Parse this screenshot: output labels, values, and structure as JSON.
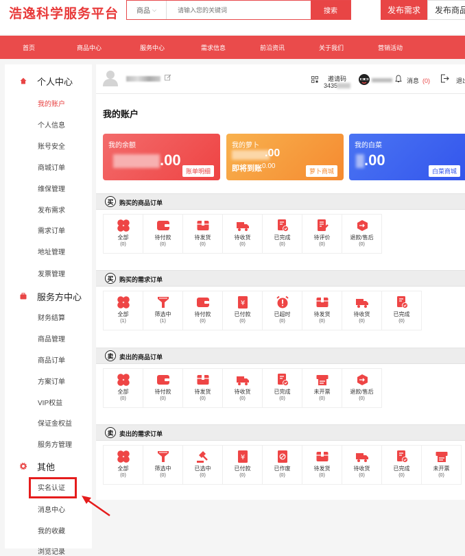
{
  "logo": "浩逸科学服务平台",
  "search": {
    "category": "商品",
    "placeholder": "请输入您的关键词",
    "button": "搜索"
  },
  "header_buttons": {
    "publish_request": "发布需求",
    "publish_goods": "发布商品"
  },
  "nav": [
    "首页",
    "商品中心",
    "服务中心",
    "需求信息",
    "前沿资讯",
    "关于我们",
    "营销活动"
  ],
  "sidebar": {
    "personal_center": "个人中心",
    "personal_items": [
      "我的账户",
      "个人信息",
      "账号安全",
      "商城订单",
      "维保管理",
      "发布需求",
      "需求订单",
      "地址管理",
      "发票管理"
    ],
    "service_center": "服务方中心",
    "service_items": [
      "财务结算",
      "商品管理",
      "商品订单",
      "方案订单",
      "VIP权益",
      "保证金权益",
      "服务方管理"
    ],
    "other": "其他",
    "other_items": [
      "实名认证",
      "消息中心",
      "我的收藏",
      "浏览记录"
    ]
  },
  "user": {
    "invite_label": "邀请码",
    "invite_code_prefix": "3435",
    "messages_label": "消息",
    "messages_count": "(0)",
    "logout": "退出"
  },
  "page_title": "我的账户",
  "cards": [
    {
      "label": "我的余额",
      "amount": ".00",
      "button": "账单明细",
      "color": "#ef4b4b"
    },
    {
      "label": "我的萝卜",
      "amount": ".00",
      "pending_label": "即将到账",
      "pending_value": "0.00",
      "button": "萝卜商城",
      "color": "#f59a3b"
    },
    {
      "label": "我的白菜",
      "amount": ".00",
      "button": "白菜商城",
      "color": "#3e5ff0"
    }
  ],
  "sections": [
    {
      "badge": "买",
      "title": "购买的商品订单",
      "items": [
        {
          "icon": "grid-icon",
          "label": "全部",
          "count": "(0)"
        },
        {
          "icon": "wallet-icon",
          "label": "待付款",
          "count": "(0)"
        },
        {
          "icon": "box-icon",
          "label": "待发货",
          "count": "(0)"
        },
        {
          "icon": "truck-icon",
          "label": "待收货",
          "count": "(0)"
        },
        {
          "icon": "doc-check-icon",
          "label": "已完成",
          "count": "(0)"
        },
        {
          "icon": "edit-doc-icon",
          "label": "待评价",
          "count": "(0)"
        },
        {
          "icon": "return-box-icon",
          "label": "退款/售后",
          "count": "(0)"
        }
      ]
    },
    {
      "badge": "买",
      "title": "购买的需求订单",
      "items": [
        {
          "icon": "grid-icon",
          "label": "全部",
          "count": "(1)"
        },
        {
          "icon": "filter-icon",
          "label": "筛选中",
          "count": "(1)"
        },
        {
          "icon": "wallet-icon",
          "label": "待付款",
          "count": "(0)"
        },
        {
          "icon": "yen-doc-icon",
          "label": "已付款",
          "count": "(0)"
        },
        {
          "icon": "alarm-icon",
          "label": "已超时",
          "count": "(0)"
        },
        {
          "icon": "box-icon",
          "label": "待发货",
          "count": "(0)"
        },
        {
          "icon": "truck-icon",
          "label": "待收货",
          "count": "(0)"
        },
        {
          "icon": "doc-check-icon",
          "label": "已完成",
          "count": "(0)"
        }
      ]
    },
    {
      "badge": "卖",
      "title": "卖出的商品订单",
      "items": [
        {
          "icon": "grid-icon",
          "label": "全部",
          "count": "(0)"
        },
        {
          "icon": "wallet-icon",
          "label": "待付款",
          "count": "(0)"
        },
        {
          "icon": "box-icon",
          "label": "待发货",
          "count": "(0)"
        },
        {
          "icon": "truck-icon",
          "label": "待收货",
          "count": "(0)"
        },
        {
          "icon": "doc-check-icon",
          "label": "已完成",
          "count": "(0)"
        },
        {
          "icon": "printer-icon",
          "label": "未开票",
          "count": "(0)"
        },
        {
          "icon": "return-box-icon",
          "label": "退款/售后",
          "count": "(0)"
        }
      ]
    },
    {
      "badge": "卖",
      "title": "卖出的需求订单",
      "items": [
        {
          "icon": "grid-icon",
          "label": "全部",
          "count": "(0)"
        },
        {
          "icon": "filter-icon",
          "label": "筛选中",
          "count": "(0)"
        },
        {
          "icon": "gavel-icon",
          "label": "已选中",
          "count": "(0)"
        },
        {
          "icon": "yen-doc-icon",
          "label": "已付款",
          "count": "(0)"
        },
        {
          "icon": "void-doc-icon",
          "label": "已作废",
          "count": "(0)"
        },
        {
          "icon": "box-icon",
          "label": "待发货",
          "count": "(0)"
        },
        {
          "icon": "truck-icon",
          "label": "待收货",
          "count": "(0)"
        },
        {
          "icon": "doc-check-icon",
          "label": "已完成",
          "count": "(0)"
        },
        {
          "icon": "printer-icon",
          "label": "未开票",
          "count": "(0)"
        }
      ]
    }
  ]
}
